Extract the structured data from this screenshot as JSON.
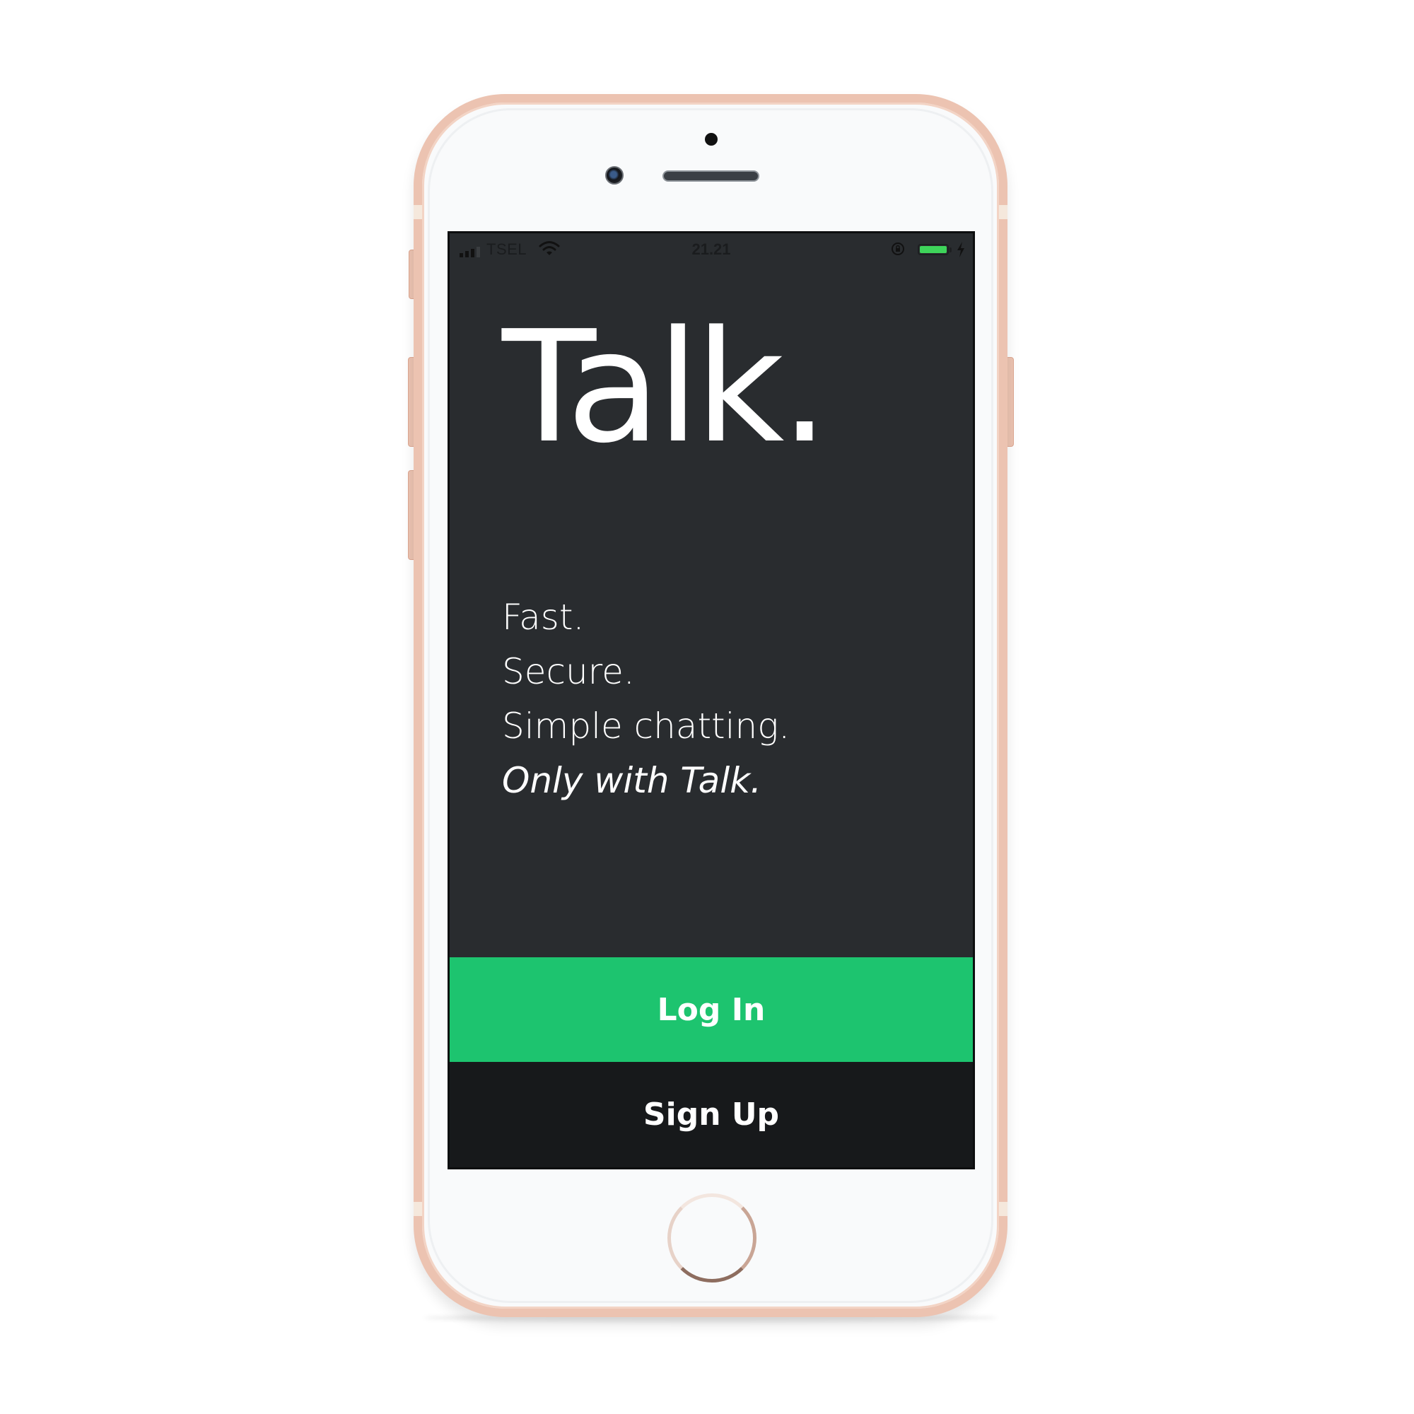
{
  "device": {
    "frame_color": "#ecc3b1",
    "face_color": "#f9fafb"
  },
  "status_bar": {
    "carrier": "TSEL",
    "time": "21.21",
    "signal_icon": "cellular-signal-icon",
    "wifi_icon": "wifi-icon",
    "lock_icon": "rotation-lock-icon",
    "battery_icon": "battery-icon",
    "charging_icon": "charging-bolt-icon",
    "battery_color": "#3ed45a"
  },
  "hero": {
    "title": "Talk."
  },
  "taglines": {
    "line1": "Fast.",
    "line2": "Secure.",
    "line3": "Simple chatting.",
    "line4": "Only with Talk."
  },
  "actions": {
    "login_label": "Log In",
    "signup_label": "Sign Up",
    "login_color": "#1dc46f",
    "signup_color": "#17191b"
  },
  "theme": {
    "background": "#292c2f",
    "text": "#ffffff"
  }
}
